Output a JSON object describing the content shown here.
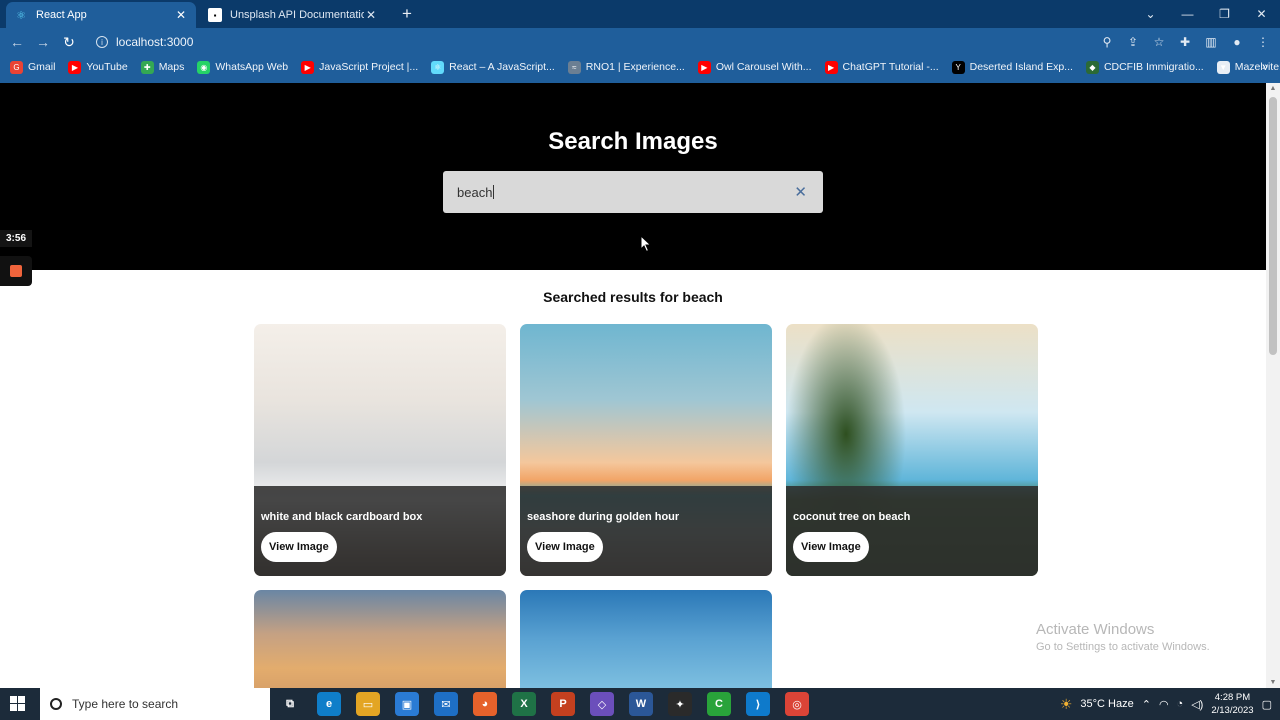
{
  "browser": {
    "tabs": [
      {
        "title": "React App",
        "active": true
      },
      {
        "title": "Unsplash API Documentation | F",
        "active": false
      }
    ],
    "url": "localhost:3000",
    "bookmarks": [
      {
        "label": "Gmail",
        "color": "#ea4335",
        "glyph": "G"
      },
      {
        "label": "YouTube",
        "color": "#ff0000",
        "glyph": "▶"
      },
      {
        "label": "Maps",
        "color": "#34a853",
        "glyph": "✚"
      },
      {
        "label": "WhatsApp Web",
        "color": "#25d366",
        "glyph": "◉"
      },
      {
        "label": "JavaScript Project |...",
        "color": "#ff0000",
        "glyph": "▶"
      },
      {
        "label": "React – A JavaScript...",
        "color": "#61dafb",
        "glyph": "⚛"
      },
      {
        "label": "RNO1 | Experience...",
        "color": "#6b7f93",
        "glyph": "≈"
      },
      {
        "label": "Owl Carousel With...",
        "color": "#ff0000",
        "glyph": "▶"
      },
      {
        "label": "ChatGPT Tutorial -...",
        "color": "#ff0000",
        "glyph": "▶"
      },
      {
        "label": "Deserted Island Exp...",
        "color": "#000000",
        "glyph": "Y"
      },
      {
        "label": "CDCFIB Immigratio...",
        "color": "#2b6a36",
        "glyph": "◆"
      },
      {
        "label": "Mazelvite: Events",
        "color": "#e8eef5",
        "glyph": "▼"
      }
    ]
  },
  "page": {
    "heading": "Search Images",
    "search": {
      "value": "beach"
    },
    "results_title": "Searched results for beach",
    "cards": [
      {
        "title": "white and black cardboard box",
        "button": "View Image"
      },
      {
        "title": "seashore during golden hour",
        "button": "View Image"
      },
      {
        "title": "coconut tree on beach",
        "button": "View Image"
      }
    ]
  },
  "recorder": {
    "time": "3:56"
  },
  "watermark": {
    "line1": "Activate Windows",
    "line2": "Go to Settings to activate Windows."
  },
  "taskbar": {
    "search_placeholder": "Type here to search",
    "weather": "35°C  Haze",
    "time": "4:28 PM",
    "date": "2/13/2023",
    "apps": [
      {
        "name": "task-view",
        "color": "#1c2b3a",
        "glyph": "⧉"
      },
      {
        "name": "edge",
        "color": "#0f7ec9",
        "glyph": "e"
      },
      {
        "name": "file-explorer",
        "color": "#e3a524",
        "glyph": "▭"
      },
      {
        "name": "store",
        "color": "#2a7bd4",
        "glyph": "▣"
      },
      {
        "name": "mail",
        "color": "#1e6fc5",
        "glyph": "✉"
      },
      {
        "name": "firefox",
        "color": "#e6622b",
        "glyph": "◕"
      },
      {
        "name": "excel",
        "color": "#1f7246",
        "glyph": "X"
      },
      {
        "name": "powerpoint",
        "color": "#c4401f",
        "glyph": "P"
      },
      {
        "name": "visual-studio",
        "color": "#6b4fbb",
        "glyph": "◇"
      },
      {
        "name": "word",
        "color": "#2b5797",
        "glyph": "W"
      },
      {
        "name": "figma",
        "color": "#2a2a2a",
        "glyph": "✦"
      },
      {
        "name": "camtasia",
        "color": "#29a33a",
        "glyph": "C"
      },
      {
        "name": "vscode",
        "color": "#0e7acb",
        "glyph": "⟩"
      },
      {
        "name": "chrome",
        "color": "#db4437",
        "glyph": "◎"
      }
    ]
  }
}
